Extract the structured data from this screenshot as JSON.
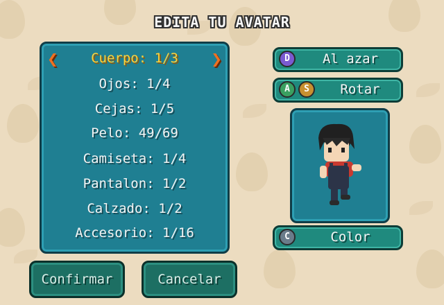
{
  "title": "EDITA TU AVATAR",
  "menu": {
    "items": [
      {
        "label": "Cuerpo: 1/3",
        "selected": true
      },
      {
        "label": "Ojos: 1/4"
      },
      {
        "label": "Cejas: 1/5"
      },
      {
        "label": "Pelo: 49/69"
      },
      {
        "label": "Camiseta: 1/4"
      },
      {
        "label": "Pantalon: 1/2"
      },
      {
        "label": "Calzado: 1/2"
      },
      {
        "label": "Accesorio: 1/16"
      }
    ],
    "left_arrow": "❮",
    "right_arrow": "❯"
  },
  "side_buttons": {
    "random": {
      "label": "Al azar",
      "key": "D"
    },
    "rotate": {
      "label": "Rotar",
      "key_a": "A",
      "key_s": "S"
    },
    "color": {
      "label": "Color",
      "key": "C"
    }
  },
  "bottom_buttons": {
    "confirm": "Confirmar",
    "cancel": "Cancelar"
  },
  "colors": {
    "panel": "#1f7f92",
    "button": "#1f8a7e",
    "selected_text": "#ffd23a",
    "arrow": "#f07020",
    "background": "#ecdcc0"
  }
}
